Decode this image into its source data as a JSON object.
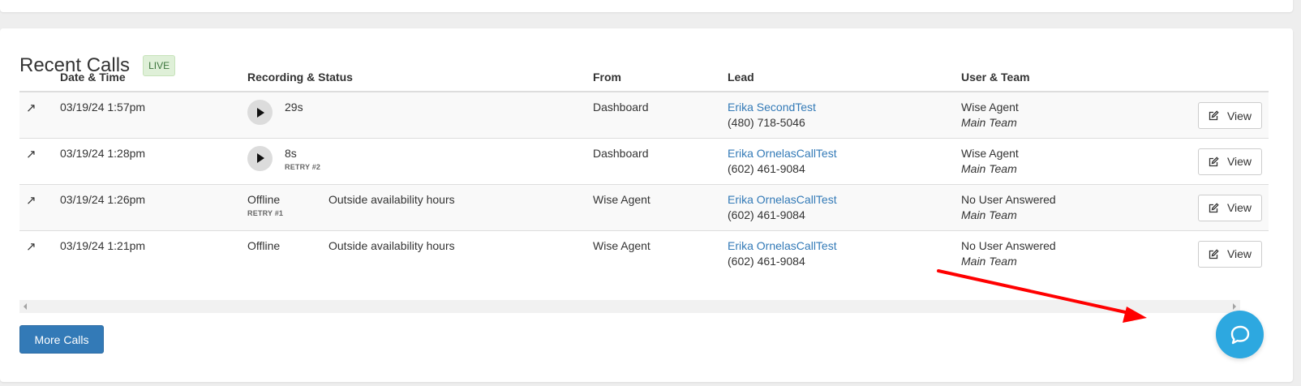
{
  "recent_calls": {
    "title": "Recent Calls",
    "live_badge": "LIVE",
    "columns": [
      "",
      "Date & Time",
      "Recording & Status",
      "From",
      "Lead",
      "User & Team",
      ""
    ],
    "rows": [
      {
        "datetime": "03/19/24 1:57pm",
        "has_recording": true,
        "duration": "29s",
        "retry": "",
        "status": "",
        "status_note": "",
        "from": "Dashboard",
        "lead_name": "Erika SecondTest",
        "lead_phone": "(480) 718-5046",
        "user": "Wise Agent",
        "team": "Main Team",
        "view_label": "View"
      },
      {
        "datetime": "03/19/24 1:28pm",
        "has_recording": true,
        "duration": "8s",
        "retry": "RETRY #2",
        "status": "",
        "status_note": "",
        "from": "Dashboard",
        "lead_name": "Erika OrnelasCallTest",
        "lead_phone": "(602) 461-9084",
        "user": "Wise Agent",
        "team": "Main Team",
        "view_label": "View"
      },
      {
        "datetime": "03/19/24 1:26pm",
        "has_recording": false,
        "duration": "",
        "retry": "RETRY #1",
        "status": "Offline",
        "status_note": "Outside availability hours",
        "from": "Wise Agent",
        "lead_name": "Erika OrnelasCallTest",
        "lead_phone": "(602) 461-9084",
        "user": "No User Answered",
        "team": "Main Team",
        "view_label": "View"
      },
      {
        "datetime": "03/19/24 1:21pm",
        "has_recording": false,
        "duration": "",
        "retry": "",
        "status": "Offline",
        "status_note": "Outside availability hours",
        "from": "Wise Agent",
        "lead_name": "Erika OrnelasCallTest",
        "lead_phone": "(602) 461-9084",
        "user": "No User Answered",
        "team": "Main Team",
        "view_label": "View"
      }
    ],
    "more_button": "More Calls"
  },
  "icons": {
    "direction": "outbound-arrow-icon",
    "play": "play-icon",
    "view": "edit-icon",
    "chat": "chat-bubble-icon"
  },
  "colors": {
    "link": "#337ab7",
    "primary_button": "#337ab7",
    "live_badge_bg": "#dff0d8",
    "live_badge_text": "#3c763d",
    "chat_fab": "#2da8e0",
    "annotation_arrow": "#ff0000"
  }
}
